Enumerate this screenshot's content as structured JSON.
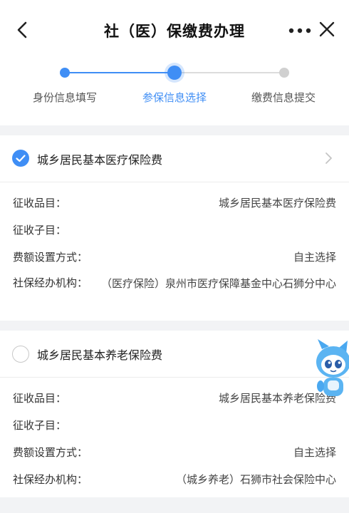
{
  "header": {
    "title": "社（医）保缴费办理",
    "back_icon": "chevron-left-icon",
    "more_icon": "more-horizontal-icon",
    "close_icon": "close-icon"
  },
  "steps": {
    "items": [
      {
        "label": "身份信息填写",
        "status": "done"
      },
      {
        "label": "参保信息选择",
        "status": "current"
      },
      {
        "label": "缴费信息提交",
        "status": "todo"
      }
    ],
    "accent": "#3f8ef5"
  },
  "cards": [
    {
      "title": "城乡居民基本医疗保险费",
      "checked": true,
      "rows": [
        {
          "key": "征收品目：",
          "value": "城乡居民基本医疗保险费"
        },
        {
          "key": "征收子目：",
          "value": ""
        },
        {
          "key": "费额设置方式：",
          "value": "自主选择"
        },
        {
          "key": "社保经办机构：",
          "value": "（医疗保险）泉州市医疗保障基金中心石狮分中心"
        }
      ]
    },
    {
      "title": "城乡居民基本养老保险费",
      "checked": false,
      "rows": [
        {
          "key": "征收品目：",
          "value": "城乡居民基本养老保险费"
        },
        {
          "key": "征收子目：",
          "value": ""
        },
        {
          "key": "费额设置方式：",
          "value": "自主选择"
        },
        {
          "key": "社保经办机构：",
          "value": "（城乡养老）石狮市社会保险中心"
        }
      ]
    }
  ]
}
